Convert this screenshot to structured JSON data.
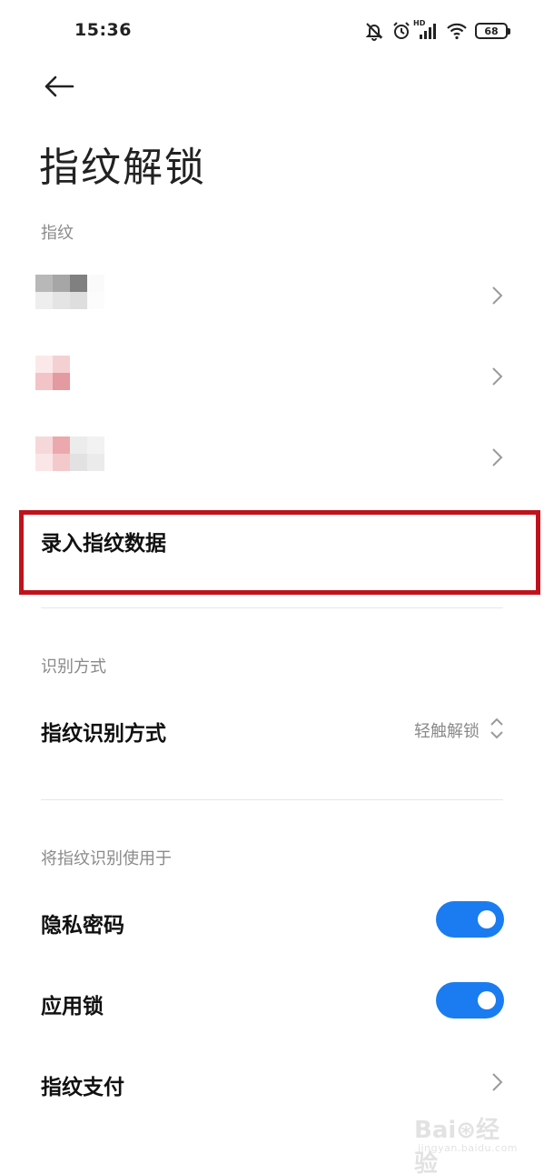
{
  "status_bar": {
    "time": "15:36",
    "network_label": "HD",
    "battery": "68",
    "icons": [
      "bell-muted-icon",
      "alarm-icon",
      "signal-icon",
      "wifi-icon",
      "battery-icon"
    ]
  },
  "header": {
    "back_icon": "arrow-left-icon",
    "title": "指纹解锁"
  },
  "fingerprints_section": {
    "title": "指纹",
    "items": [
      {
        "label_obscured": true,
        "icon": "chevron-right-icon"
      },
      {
        "label_obscured": true,
        "icon": "chevron-right-icon"
      },
      {
        "label_obscured": true,
        "icon": "chevron-right-icon"
      }
    ],
    "add_label": "录入指纹数据",
    "highlight_color": "#c0121c"
  },
  "recognition_section": {
    "title": "识别方式",
    "row_label": "指纹识别方式",
    "row_value": "轻触解锁",
    "value_icon": "chevron-up-down-icon"
  },
  "usage_section": {
    "title": "将指纹识别使用于",
    "items": [
      {
        "label": "隐私密码",
        "control": "toggle",
        "on": true
      },
      {
        "label": "应用锁",
        "control": "toggle",
        "on": true
      },
      {
        "label": "指纹支付",
        "control": "chevron-right-icon"
      }
    ],
    "toggle_color": "#1a7cf0"
  },
  "watermark": {
    "main": "Bai⊛经验",
    "sub": "jingyan.baidu.com"
  }
}
